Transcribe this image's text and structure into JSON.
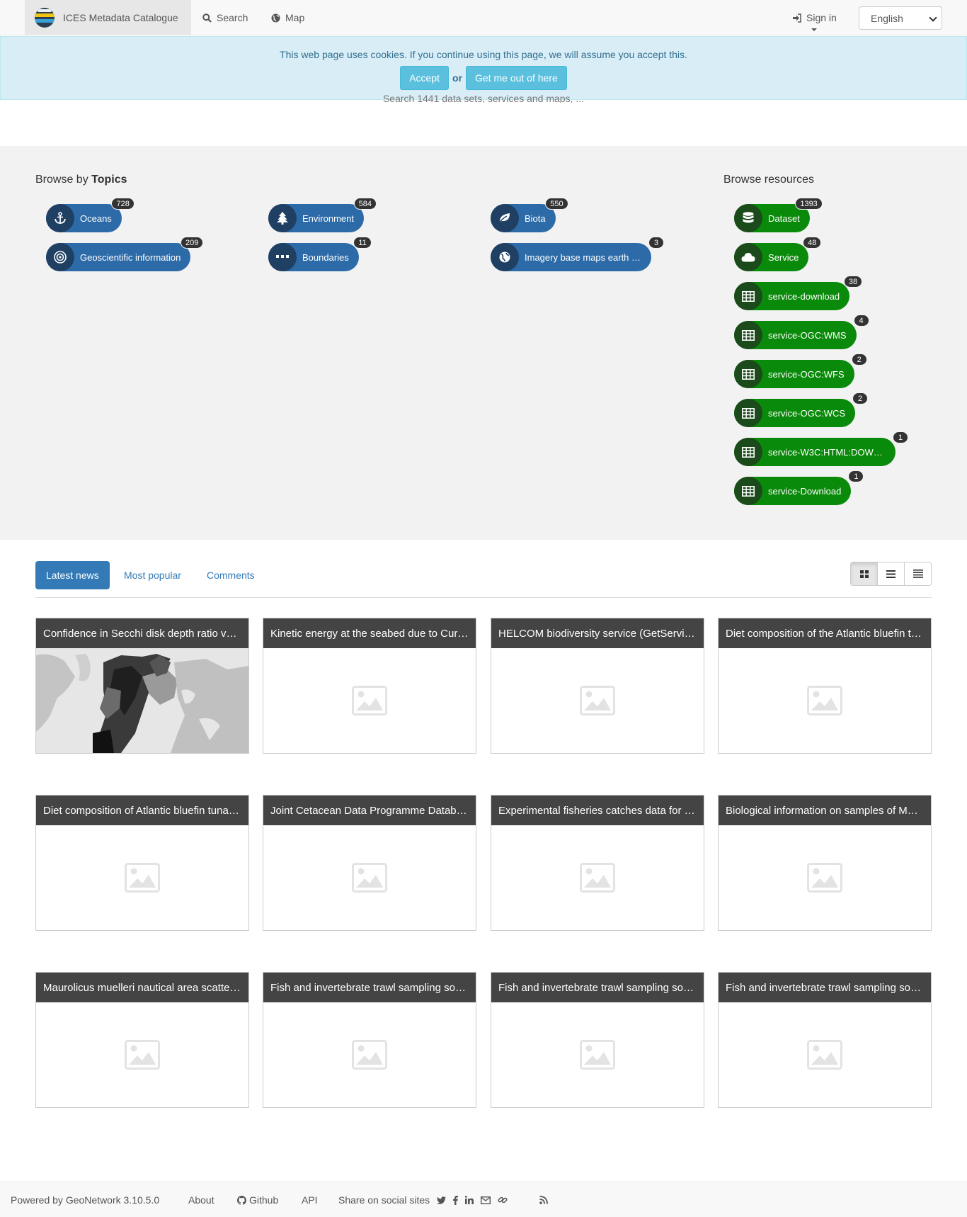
{
  "navbar": {
    "brand": "ICES Metadata Catalogue",
    "search_label": "Search",
    "map_label": "Map",
    "signin_label": "Sign in",
    "language": "English"
  },
  "cookie": {
    "message": "This web page uses cookies. If you continue using this page, we will assume you accept this.",
    "accept_label": "Accept",
    "or_label": "or",
    "leave_label": "Get me out of here"
  },
  "search_hint": "Search 1441 data sets, services and maps, ...",
  "browse": {
    "topics_prefix": "Browse by",
    "topics_bold": "Topics",
    "resources_title": "Browse resources",
    "topics": [
      {
        "label": "Oceans",
        "count": "728",
        "icon": "anchor-icon"
      },
      {
        "label": "Environment",
        "count": "584",
        "icon": "tree-icon"
      },
      {
        "label": "Biota",
        "count": "550",
        "icon": "leaf-icon"
      },
      {
        "label": "Geoscientific information",
        "count": "209",
        "icon": "bullseye-icon"
      },
      {
        "label": "Boundaries",
        "count": "11",
        "icon": "ellipsis-icon"
      },
      {
        "label": "Imagery base maps earth …",
        "count": "3",
        "icon": "globe-icon"
      }
    ],
    "resources": [
      {
        "label": "Dataset",
        "count": "1393",
        "icon": "database-icon"
      },
      {
        "label": "Service",
        "count": "48",
        "icon": "cloud-icon"
      },
      {
        "label": "service-download",
        "count": "38",
        "icon": "table-icon"
      },
      {
        "label": "service-OGC:WMS",
        "count": "4",
        "icon": "table-icon"
      },
      {
        "label": "service-OGC:WFS",
        "count": "2",
        "icon": "table-icon"
      },
      {
        "label": "service-OGC:WCS",
        "count": "2",
        "icon": "table-icon"
      },
      {
        "label": "service-W3C:HTML:DOW…",
        "count": "1",
        "icon": "table-icon"
      },
      {
        "label": "service-Download",
        "count": "1",
        "icon": "table-icon"
      }
    ]
  },
  "tabs": {
    "latest": "Latest news",
    "popular": "Most popular",
    "comments": "Comments"
  },
  "cards": [
    {
      "title": "Confidence in Secchi disk depth ratio v…",
      "thumb": "map"
    },
    {
      "title": "Kinetic energy at the seabed due to Cur…",
      "thumb": "placeholder"
    },
    {
      "title": "HELCOM biodiversity service (GetServi…",
      "thumb": "placeholder"
    },
    {
      "title": "Diet composition of the Atlantic bluefin t…",
      "thumb": "placeholder"
    },
    {
      "title": "Diet composition of Atlantic bluefin tuna …",
      "thumb": "placeholder"
    },
    {
      "title": "Joint Cetacean Data Programme Datab…",
      "thumb": "placeholder"
    },
    {
      "title": "Experimental fisheries catches data for …",
      "thumb": "placeholder"
    },
    {
      "title": "Biological information on samples of Ma…",
      "thumb": "placeholder"
    },
    {
      "title": "Maurolicus muelleri nautical area scatte…",
      "thumb": "placeholder"
    },
    {
      "title": "Fish and invertebrate trawl sampling so…",
      "thumb": "placeholder"
    },
    {
      "title": "Fish and invertebrate trawl sampling so…",
      "thumb": "placeholder"
    },
    {
      "title": "Fish and invertebrate trawl sampling so…",
      "thumb": "placeholder"
    }
  ],
  "footer": {
    "powered": "Powered by GeoNetwork 3.10.5.0",
    "about": "About",
    "github": "Github",
    "api": "API",
    "share": "Share on social sites"
  },
  "colors": {
    "topic_chip": "#2d6ba8",
    "resource_chip": "#0a8a0a",
    "primary": "#337ab7",
    "cookie_bg": "#d9edf7"
  }
}
